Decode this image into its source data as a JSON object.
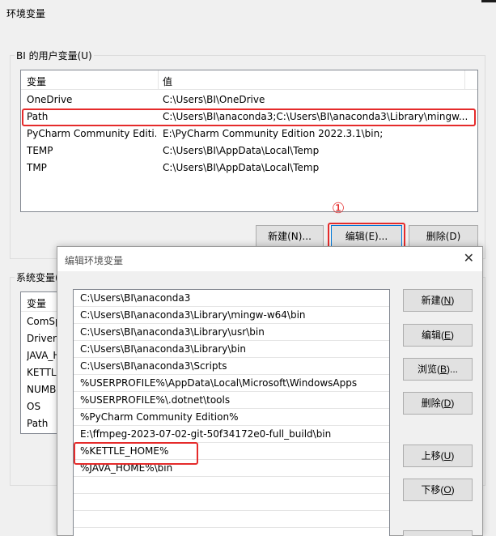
{
  "main_dialog": {
    "title": "环境变量",
    "user_group_label": "BI 的用户变量(U)",
    "user_vars": {
      "columns": [
        "变量",
        "值"
      ],
      "rows": [
        {
          "name": "OneDrive",
          "value": "C:\\Users\\BI\\OneDrive"
        },
        {
          "name": "Path",
          "value": "C:\\Users\\BI\\anaconda3;C:\\Users\\BI\\anaconda3\\Library\\mingw..."
        },
        {
          "name": "PyCharm Community Editi...",
          "value": "E:\\PyCharm Community Edition 2022.3.1\\bin;"
        },
        {
          "name": "TEMP",
          "value": "C:\\Users\\BI\\AppData\\Local\\Temp"
        },
        {
          "name": "TMP",
          "value": "C:\\Users\\BI\\AppData\\Local\\Temp"
        }
      ]
    },
    "marker": "①",
    "buttons": {
      "new": "新建(N)...",
      "edit": "编辑(E)...",
      "delete": "删除(D)"
    },
    "system_group_label": "系统变量(",
    "system_vars": {
      "column": "变量",
      "rows": [
        "ComSp",
        "DriverD",
        "JAVA_H",
        "KETTLE",
        "NUMB",
        "OS",
        "Path"
      ]
    }
  },
  "edit_dialog": {
    "title": "编辑环境变量",
    "close_glyph": "✕",
    "paths": [
      "C:\\Users\\BI\\anaconda3",
      "C:\\Users\\BI\\anaconda3\\Library\\mingw-w64\\bin",
      "C:\\Users\\BI\\anaconda3\\Library\\usr\\bin",
      "C:\\Users\\BI\\anaconda3\\Library\\bin",
      "C:\\Users\\BI\\anaconda3\\Scripts",
      "%USERPROFILE%\\AppData\\Local\\Microsoft\\WindowsApps",
      "%USERPROFILE%\\.dotnet\\tools",
      "%PyCharm Community Edition%",
      "E:\\ffmpeg-2023-07-02-git-50f34172e0-full_build\\bin",
      "%KETTLE_HOME%",
      "%JAVA_HOME%\\bin"
    ],
    "buttons": {
      "new": {
        "text": "新建(",
        "key": "N",
        "end": ")"
      },
      "edit": {
        "text": "编辑(",
        "key": "E",
        "end": ")"
      },
      "browse": {
        "text": "浏览(",
        "key": "B",
        "end": ")..."
      },
      "delete": {
        "text": "删除(",
        "key": "D",
        "end": ")"
      },
      "move_up": {
        "text": "上移(",
        "key": "U",
        "end": ")"
      },
      "move_down": {
        "text": "下移(",
        "key": "O",
        "end": ")"
      }
    }
  },
  "colors": {
    "highlight": "#e52b2b",
    "accent": "#0078d7"
  }
}
